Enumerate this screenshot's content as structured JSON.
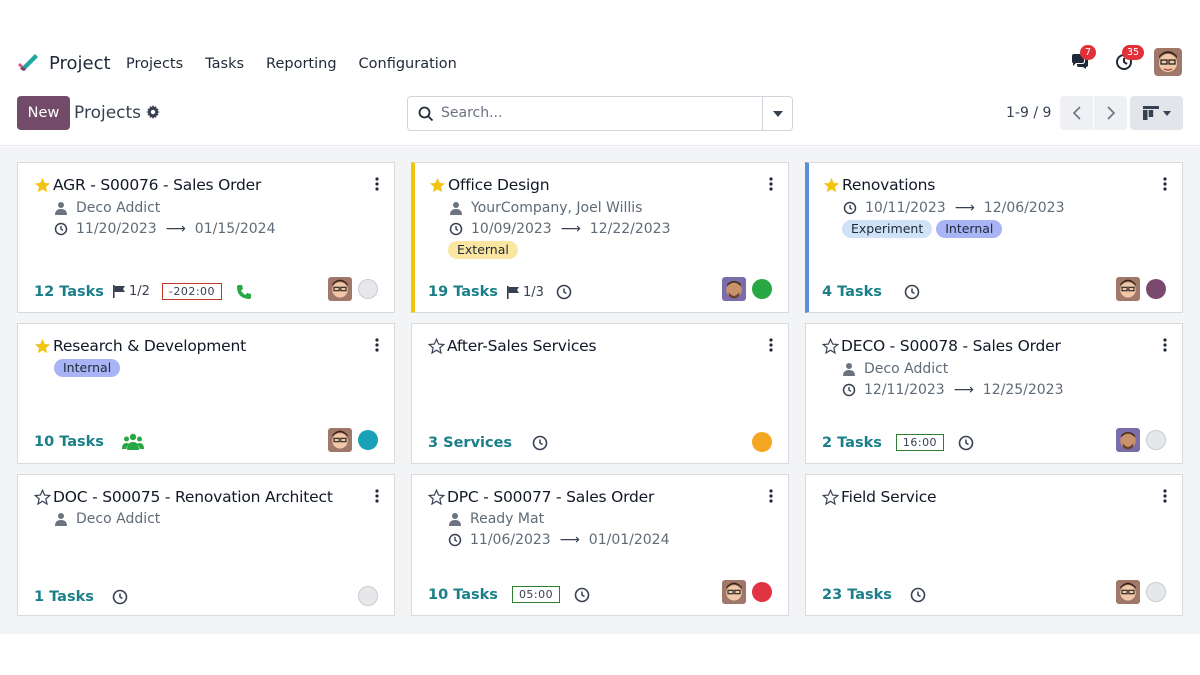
{
  "navbar": {
    "app_name": "Project",
    "menu": [
      "Projects",
      "Tasks",
      "Reporting",
      "Configuration"
    ],
    "messages_count": "7",
    "activities_count": "35"
  },
  "control_panel": {
    "new_label": "New",
    "title": "Projects",
    "search_placeholder": "Search...",
    "pager": "1-9 / 9"
  },
  "colors": {
    "brand": "#714b67",
    "tasks_link": "#1b7f8a",
    "star_active": "#f1c40f"
  },
  "cards": [
    {
      "title": "AGR - S00076 - Sales Order",
      "favorite": true,
      "customer": "Deco Addict",
      "date_start": "11/20/2023",
      "date_end": "01/15/2024",
      "tasks": "12 Tasks",
      "milestones": "1/2",
      "deadline": "-202:00",
      "status_color": "#e5e7eb"
    },
    {
      "title": "Office Design",
      "favorite": true,
      "customer": "YourCompany, Joel Willis",
      "date_start": "10/09/2023",
      "date_end": "12/22/2023",
      "tags": [
        {
          "label": "External",
          "color": "#fbe6a1"
        }
      ],
      "tasks": "19 Tasks",
      "milestones": "1/3",
      "status_color": "#28a745"
    },
    {
      "title": "Renovations",
      "favorite": true,
      "date_start": "10/11/2023",
      "date_end": "12/06/2023",
      "tags": [
        {
          "label": "Experiment",
          "color": "#cfe2f7"
        },
        {
          "label": "Internal",
          "color": "#a8b4f5"
        }
      ],
      "tasks": "4 Tasks",
      "status_color": "#7a4a6e"
    },
    {
      "title": "Research & Development",
      "favorite": true,
      "tags": [
        {
          "label": "Internal",
          "color": "#a8b4f5"
        }
      ],
      "tasks": "10 Tasks",
      "status_color": "#17a2b8"
    },
    {
      "title": "After-Sales Services",
      "favorite": false,
      "tasks": "3 Services",
      "status_color": "#f5a623"
    },
    {
      "title": "DECO - S00078 - Sales Order",
      "favorite": false,
      "customer": "Deco Addict",
      "date_start": "12/11/2023",
      "date_end": "12/25/2023",
      "tasks": "2 Tasks",
      "deadline": "16:00",
      "status_color": "#e5e7eb"
    },
    {
      "title": "DOC - S00075 - Renovation Architect",
      "favorite": false,
      "customer": "Deco Addict",
      "tasks": "1 Tasks",
      "status_color": "#e5e7eb"
    },
    {
      "title": "DPC - S00077 - Sales Order",
      "favorite": false,
      "customer": "Ready Mat",
      "date_start": "11/06/2023",
      "date_end": "01/01/2024",
      "tasks": "10 Tasks",
      "deadline": "05:00",
      "status_color": "#e03444"
    },
    {
      "title": "Field Service",
      "favorite": false,
      "tasks": "23 Tasks",
      "status_color": "#e5e7eb"
    }
  ]
}
